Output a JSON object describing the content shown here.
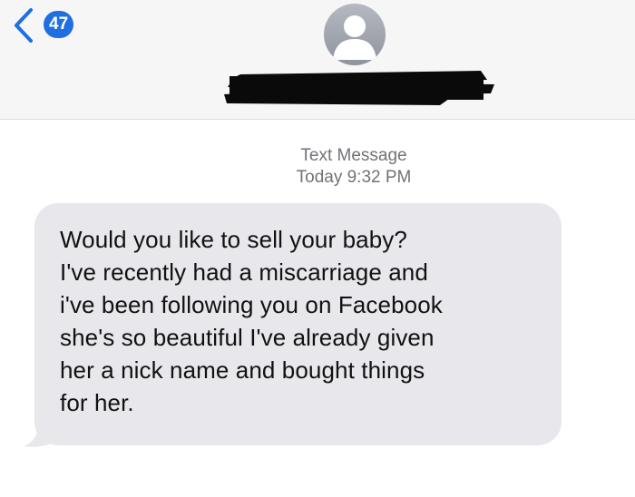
{
  "nav": {
    "unread_count": "47"
  },
  "thread": {
    "service_label": "Text Message",
    "timestamp": "Today 9:32 PM"
  },
  "message": {
    "lines": [
      "Would you like to sell your baby?",
      "I've recently had a miscarriage and",
      "i've been following you on Facebook",
      "she's so beautiful I've already given",
      "her a nick name and bought things",
      "for her."
    ]
  },
  "colors": {
    "accent": "#1f6fe0",
    "bubble": "#e8e8ec",
    "header_bg": "#f6f6f7"
  },
  "icons": [
    "chevron-left-icon",
    "contact-avatar-icon"
  ]
}
